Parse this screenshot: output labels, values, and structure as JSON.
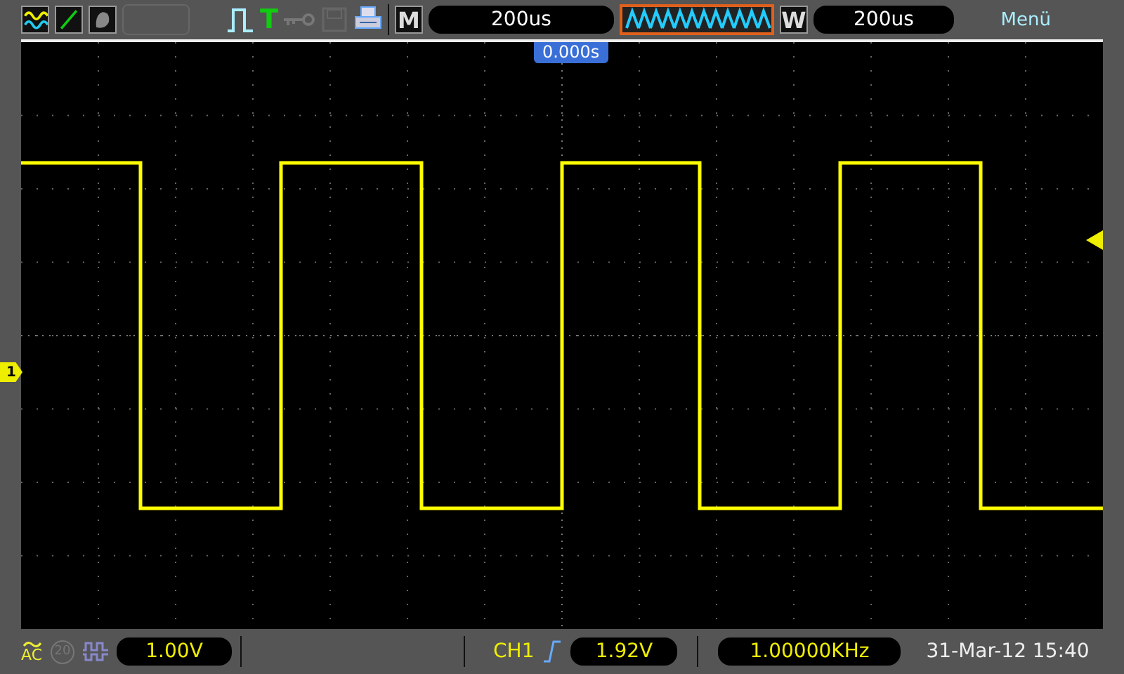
{
  "toolbar": {
    "trigger_mode_label": "T",
    "main_label": "M",
    "main_timebase": "200us",
    "window_label": "W",
    "window_timebase": "200us",
    "menu": "Menü"
  },
  "screen": {
    "trigger_position": "0.000s",
    "channel_marker": "1"
  },
  "status_bar": {
    "coupling": "AC",
    "bandwidth_limit": "20",
    "volts_per_div": "1.00V",
    "trigger_source": "CH1",
    "trigger_level": "1.92V",
    "frequency": "1.00000KHz",
    "datetime": "31-Mar-12 15:40"
  }
}
